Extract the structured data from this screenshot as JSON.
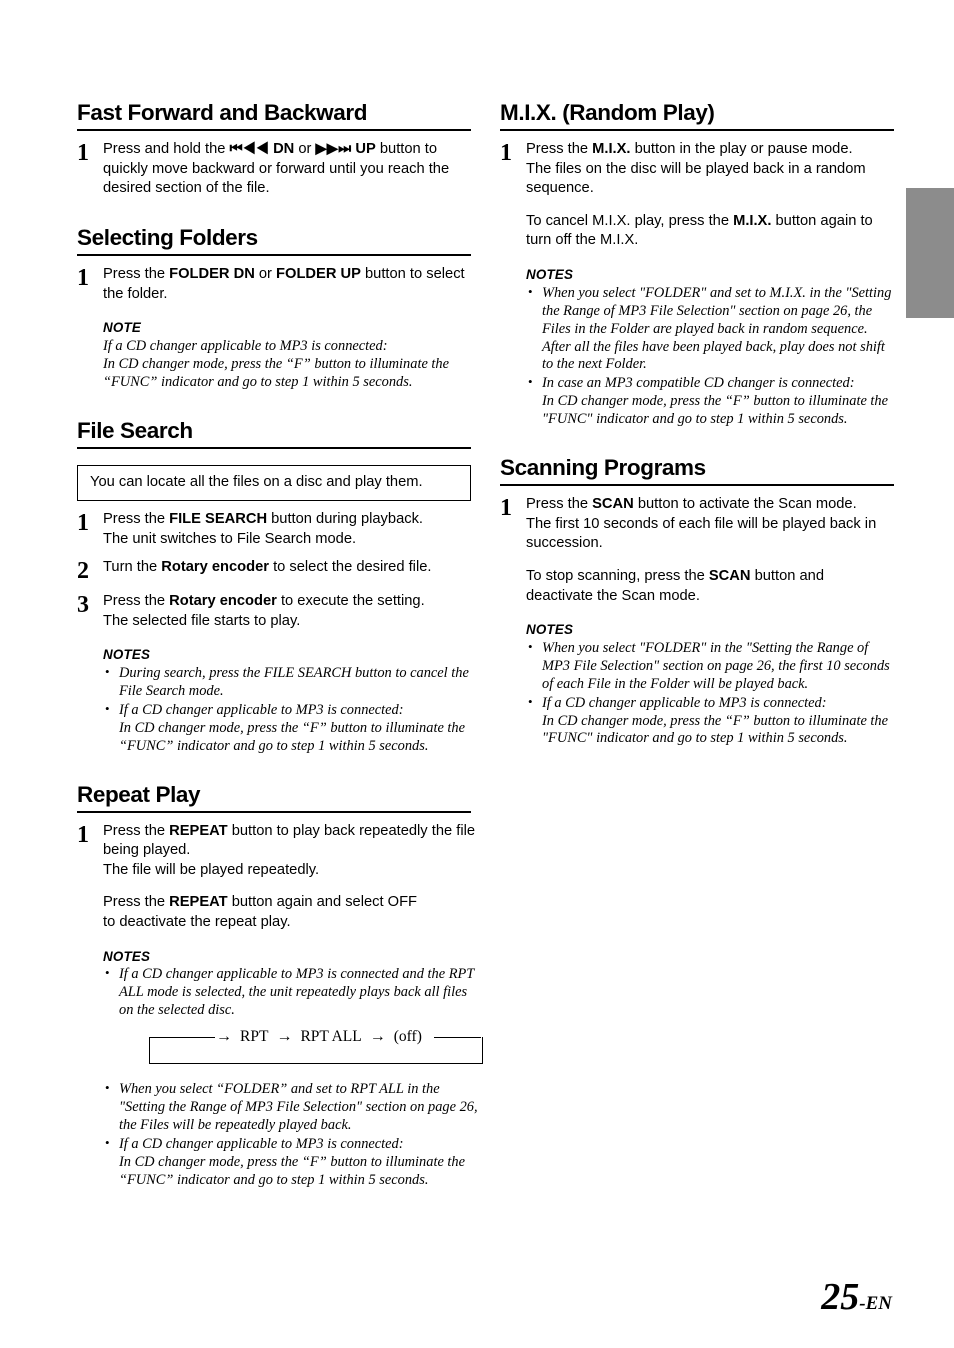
{
  "page": {
    "number": "25",
    "suffix": "-EN",
    "edge_tab_color": "#8c8c8c"
  },
  "left_column": {
    "sections": [
      {
        "heading": "Fast Forward and Backward",
        "steps": [
          {
            "number": "1",
            "paragraphs_html": [
              "Press and hold the <b>⏮◀◀ DN</b> or <b>▶▶⏭ UP</b> button to quickly move backward or forward until you reach the desired section of the file."
            ]
          }
        ]
      },
      {
        "heading": "Selecting Folders",
        "steps": [
          {
            "number": "1",
            "paragraphs_html": [
              "Press the <b>FOLDER DN</b> or <b>FOLDER UP</b> button to select the folder."
            ],
            "note": {
              "title": "NOTE",
              "lines": [
                "If a CD changer applicable to MP3 is connected:",
                "In CD changer mode, press the “F” button to illuminate the “FUNC” indicator and go to step 1 within 5 seconds."
              ]
            }
          }
        ]
      },
      {
        "heading": "File Search",
        "callout": "You can locate all the files on a disc and play them.",
        "steps": [
          {
            "number": "1",
            "paragraphs_html": [
              "Press the <b>FILE SEARCH</b> button during playback.<br>The unit switches to File Search mode."
            ]
          },
          {
            "number": "2",
            "paragraphs_html": [
              "Turn the <b>Rotary encoder</b> to select the desired file."
            ]
          },
          {
            "number": "3",
            "paragraphs_html": [
              "Press the <b>Rotary encoder</b> to execute the setting.<br>The selected file starts to play."
            ],
            "notes": {
              "title": "NOTES",
              "items": [
                [
                  "During search, press the FILE SEARCH button to cancel the File Search mode."
                ],
                [
                  "If a CD changer applicable to MP3 is connected:",
                  "In CD changer mode, press the “F” button to illuminate the “FUNC” indicator and go to step 1 within 5 seconds."
                ]
              ]
            }
          }
        ]
      },
      {
        "heading": "Repeat Play",
        "steps": [
          {
            "number": "1",
            "paragraphs_html": [
              "Press the <b>REPEAT</b> button to play back repeatedly the file being played.<br>The file will be played repeatedly.",
              "Press the <b>REPEAT</b> button again and select OFF<br>to deactivate the repeat play."
            ],
            "notes": {
              "title": "NOTES",
              "items": [
                [
                  "If a CD changer applicable to MP3 is connected and the RPT ALL mode is selected, the unit repeatedly plays back all files on the selected disc."
                ]
              ],
              "cycle": {
                "items": [
                  "RPT",
                  "RPT ALL",
                  "(off)"
                ],
                "arrow": "→"
              },
              "items_after": [
                [
                  "When you select “FOLDER” and set to RPT ALL in the \"Setting the Range of MP3 File Selection\" section on page 26, the Files will be repeatedly played back."
                ],
                [
                  "If a CD changer applicable to MP3 is connected:",
                  "In CD changer mode, press the “F” button to illuminate the “FUNC” indicator and go to step 1 within 5 seconds."
                ]
              ]
            }
          }
        ]
      }
    ]
  },
  "right_column": {
    "sections": [
      {
        "heading": "M.I.X. (Random Play)",
        "steps": [
          {
            "number": "1",
            "paragraphs_html": [
              "Press the <b>M.I.X.</b> button in the play or pause mode.<br>The files on the disc will be played back in a random sequence.",
              "To cancel M.I.X. play, press the <b>M.I.X.</b> button again to turn off the M.I.X."
            ],
            "notes": {
              "title": "NOTES",
              "items": [
                [
                  "When you select \"FOLDER\" and set to M.I.X. in the \"Setting the Range of MP3 File Selection\" section on page 26, the Files in the Folder are played back in random sequence. After all the files have been played back, play does not shift to the next Folder."
                ],
                [
                  "In case an MP3 compatible CD changer is connected:",
                  "In CD changer mode, press the “F” button to illuminate the \"FUNC\" indicator and go to step 1 within 5 seconds."
                ]
              ]
            }
          }
        ]
      },
      {
        "heading": "Scanning Programs",
        "steps": [
          {
            "number": "1",
            "paragraphs_html": [
              "Press the <b>SCAN</b> button to activate the Scan mode.<br>The first 10 seconds of each file will be played back in succession.",
              "To stop scanning, press the <b>SCAN</b> button and deactivate the Scan mode."
            ],
            "notes": {
              "title": "NOTES",
              "items": [
                [
                  "When you select \"FOLDER\" in the \"Setting the Range of MP3 File Selection\" section on page 26, the first 10 seconds of each File in the Folder will be played back."
                ],
                [
                  "If a CD changer applicable to MP3 is connected:",
                  "In CD changer mode, press the “F” button to illuminate the \"FUNC\" indicator and go to step 1 within 5 seconds."
                ]
              ]
            }
          }
        ]
      }
    ]
  }
}
